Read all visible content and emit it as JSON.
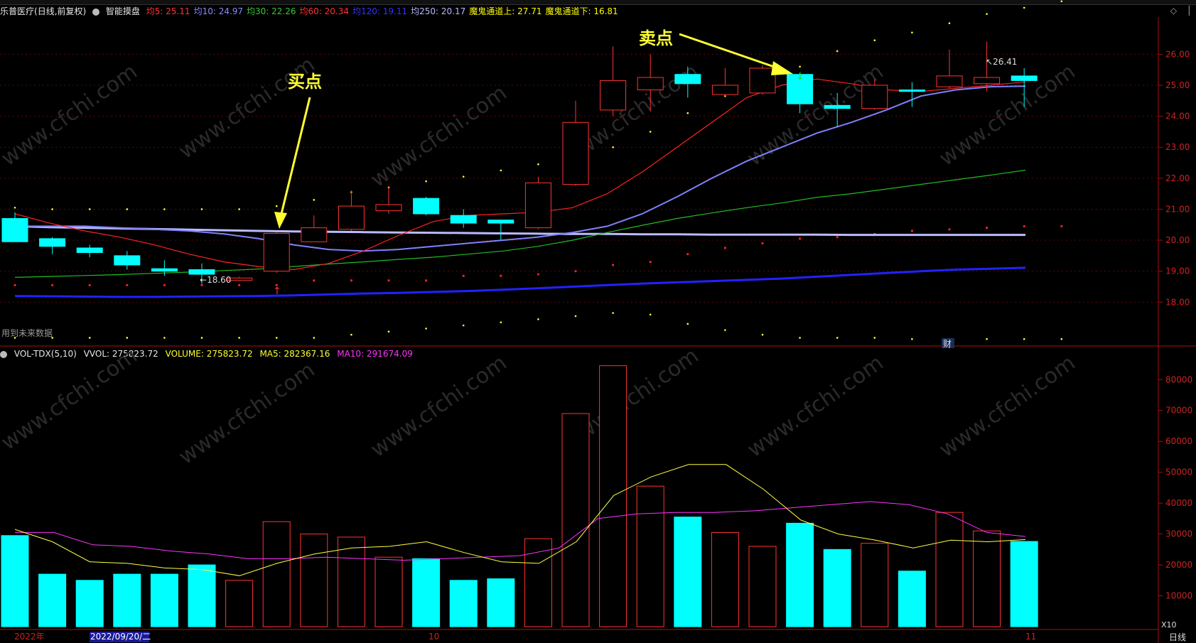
{
  "header": {
    "stock": "乐普医疗",
    "period": "(日线,前复权)",
    "indicator_name": "智能摸盘",
    "ma_labels": [
      {
        "text": "均5: 25.11",
        "color": "#ff3333"
      },
      {
        "text": "均10: 24.97",
        "color": "#8a8aff"
      },
      {
        "text": "均30: 22.26",
        "color": "#33cc33"
      },
      {
        "text": "均60: 20.34",
        "color": "#ff3333"
      },
      {
        "text": "均120: 19.11",
        "color": "#3333ff"
      },
      {
        "text": "均250: 20.17",
        "color": "#b8b8ff"
      },
      {
        "text": "魔鬼通道上: 27.71",
        "color": "#ffff00"
      },
      {
        "text": "魔鬼通道下: 16.81",
        "color": "#ffff00"
      }
    ]
  },
  "vol_header": {
    "name": "VOL-TDX(5,10)",
    "vvol": "VVOL: 275823.72",
    "volume": "VOLUME: 275823.72",
    "ma5": "MA5: 282367.16",
    "ma10": "MA10: 291674.09"
  },
  "annotations": {
    "buy": "买点",
    "sell": "卖点",
    "future_data": "用到未来数据",
    "cai": "财",
    "min_label": "18.60",
    "max_label": "26.41"
  },
  "x_axis": {
    "year": "2022年",
    "cursor_date": "2022/09/20/二",
    "oct": "10",
    "nov": "11",
    "period_tab": "日线",
    "zoom": "X10"
  },
  "colors": {
    "up": "#ff3333",
    "down": "#00ffff",
    "ma5": "#ff2222",
    "ma10": "#8080ff",
    "ma30": "#22bb22",
    "ma60": "#bbbbff",
    "ma120": "#2222ff",
    "vol_ma5": "#ffff44",
    "vol_ma10": "#ff33ff"
  },
  "chart_data": [
    {
      "type": "candlestick",
      "yticks": [
        18.0,
        19.0,
        20.0,
        21.0,
        22.0,
        23.0,
        24.0,
        25.0,
        26.0
      ],
      "ylim": [
        16.7,
        27.2
      ],
      "candles": [
        {
          "o": 20.7,
          "c": 19.95,
          "h": 20.9,
          "l": 19.95
        },
        {
          "o": 20.05,
          "c": 19.8,
          "h": 20.1,
          "l": 19.55
        },
        {
          "o": 19.75,
          "c": 19.6,
          "h": 19.85,
          "l": 19.45
        },
        {
          "o": 19.5,
          "c": 19.2,
          "h": 19.65,
          "l": 19.05
        },
        {
          "o": 19.08,
          "c": 19.0,
          "h": 19.35,
          "l": 18.85
        },
        {
          "o": 19.05,
          "c": 18.9,
          "h": 19.25,
          "l": 18.6
        },
        {
          "o": 18.7,
          "c": 18.78,
          "h": 18.82,
          "l": 18.68
        },
        {
          "o": 19.0,
          "c": 20.22,
          "h": 20.25,
          "l": 18.95
        },
        {
          "o": 19.95,
          "c": 20.4,
          "h": 20.8,
          "l": 19.95
        },
        {
          "o": 20.35,
          "c": 21.1,
          "h": 21.6,
          "l": 20.3
        },
        {
          "o": 20.95,
          "c": 21.15,
          "h": 21.75,
          "l": 20.85
        },
        {
          "o": 21.35,
          "c": 20.85,
          "h": 21.4,
          "l": 20.8
        },
        {
          "o": 20.8,
          "c": 20.55,
          "h": 21.0,
          "l": 20.4
        },
        {
          "o": 20.65,
          "c": 20.55,
          "h": 20.65,
          "l": 20.0
        },
        {
          "o": 20.4,
          "c": 21.85,
          "h": 22.05,
          "l": 20.35
        },
        {
          "o": 21.8,
          "c": 23.8,
          "h": 24.5,
          "l": 21.75
        },
        {
          "o": 24.2,
          "c": 25.15,
          "h": 26.25,
          "l": 24.0
        },
        {
          "o": 24.85,
          "c": 25.25,
          "h": 26.0,
          "l": 24.15
        },
        {
          "o": 25.35,
          "c": 25.05,
          "h": 25.6,
          "l": 24.6
        },
        {
          "o": 24.7,
          "c": 25.0,
          "h": 25.55,
          "l": 24.65
        },
        {
          "o": 24.75,
          "c": 25.55,
          "h": 25.65,
          "l": 24.7
        },
        {
          "o": 25.35,
          "c": 24.4,
          "h": 25.4,
          "l": 24.1
        },
        {
          "o": 24.35,
          "c": 24.25,
          "h": 24.75,
          "l": 23.65
        },
        {
          "o": 24.25,
          "c": 25.0,
          "h": 25.2,
          "l": 24.2
        },
        {
          "o": 24.85,
          "c": 24.8,
          "h": 25.1,
          "l": 24.3
        },
        {
          "o": 24.95,
          "c": 25.3,
          "h": 26.15,
          "l": 24.9
        },
        {
          "o": 25.05,
          "c": 25.25,
          "h": 26.41,
          "l": 24.8
        },
        {
          "o": 25.3,
          "c": 25.15,
          "h": 25.55,
          "l": 24.3
        }
      ],
      "ma5": [
        20.85,
        20.55,
        20.3,
        20.1,
        19.85,
        19.55,
        19.3,
        19.15,
        19.05,
        19.25,
        19.65,
        20.15,
        20.6,
        20.8,
        20.85,
        20.9,
        21.05,
        21.5,
        22.2,
        23.0,
        23.8,
        24.6,
        25.0,
        25.2,
        25.05,
        24.85,
        24.8,
        24.9,
        25.0,
        25.11
      ],
      "ma10": [
        20.45,
        20.45,
        20.45,
        20.4,
        20.35,
        20.3,
        20.2,
        20.05,
        19.85,
        19.7,
        19.65,
        19.7,
        19.8,
        19.9,
        20.0,
        20.1,
        20.25,
        20.45,
        20.85,
        21.4,
        22.0,
        22.55,
        23.0,
        23.45,
        23.8,
        24.2,
        24.65,
        24.85,
        24.95,
        24.97
      ],
      "ma30": [
        18.8,
        18.83,
        18.86,
        18.89,
        18.93,
        18.97,
        19.02,
        19.07,
        19.15,
        19.23,
        19.3,
        19.38,
        19.45,
        19.55,
        19.65,
        19.8,
        20.0,
        20.25,
        20.48,
        20.7,
        20.88,
        21.05,
        21.2,
        21.38,
        21.5,
        21.65,
        21.8,
        21.95,
        22.1,
        22.26
      ],
      "ma60": [
        20.5,
        20.49,
        20.48,
        20.47,
        20.46,
        20.45,
        20.44,
        20.43,
        20.42,
        20.41,
        20.4,
        20.39,
        20.38,
        20.37,
        20.36,
        20.35,
        20.35,
        20.35,
        20.34,
        20.34,
        20.34,
        20.34,
        20.34,
        20.34,
        20.34,
        20.34,
        20.34,
        20.34,
        20.34,
        20.34
      ],
      "ma120": [
        18.2,
        18.19,
        18.18,
        18.17,
        18.17,
        18.18,
        18.19,
        18.2,
        18.22,
        18.25,
        18.28,
        18.3,
        18.33,
        18.36,
        18.4,
        18.45,
        18.5,
        18.55,
        18.6,
        18.64,
        18.68,
        18.72,
        18.76,
        18.82,
        18.88,
        18.94,
        19.0,
        19.05,
        19.08,
        19.11
      ],
      "ma250": [
        20.45,
        20.42,
        20.4,
        20.38,
        20.36,
        20.34,
        20.32,
        20.3,
        20.28,
        20.27,
        20.26,
        20.25,
        20.24,
        20.23,
        20.22,
        20.21,
        20.2,
        20.2,
        20.19,
        20.19,
        20.18,
        20.18,
        20.18,
        20.18,
        20.17,
        20.17,
        20.17,
        20.17,
        20.17,
        20.17
      ],
      "channel_upper": [
        21.05,
        21.0,
        21.0,
        21.0,
        21.0,
        21.0,
        21.0,
        21.1,
        21.3,
        21.55,
        21.7,
        21.9,
        22.05,
        22.25,
        22.45,
        22.7,
        23.0,
        23.5,
        24.1,
        24.65,
        25.2,
        25.6,
        26.1,
        26.45,
        26.7,
        27.0,
        27.3,
        27.5,
        27.71
      ],
      "channel_lower": [
        16.85,
        16.85,
        16.85,
        16.85,
        16.85,
        16.85,
        16.85,
        16.85,
        16.85,
        16.95,
        17.05,
        17.15,
        17.25,
        17.35,
        17.45,
        17.55,
        17.65,
        17.6,
        17.3,
        17.1,
        16.95,
        16.85,
        16.85,
        16.85,
        16.81,
        16.81,
        16.81,
        16.81,
        16.81
      ],
      "red_dots": [
        18.55,
        18.55,
        18.55,
        18.55,
        18.55,
        18.55,
        18.55,
        18.55,
        18.7,
        18.7,
        18.7,
        18.7,
        18.85,
        18.85,
        18.9,
        19.0,
        19.2,
        19.3,
        19.55,
        19.75,
        19.9,
        20.05,
        20.1,
        20.2,
        20.3,
        20.35,
        20.4,
        20.45,
        20.45
      ]
    },
    {
      "type": "bar",
      "yticks": [
        10000,
        20000,
        30000,
        40000,
        50000,
        60000,
        70000,
        80000
      ],
      "ylim": [
        0,
        86500
      ],
      "volume": [
        29500,
        17000,
        15000,
        17000,
        17000,
        20000,
        15000,
        34000,
        30000,
        29000,
        22500,
        22000,
        15000,
        15500,
        28500,
        69000,
        84500,
        45500,
        35500,
        30500,
        26000,
        33500,
        25000,
        27000,
        18000,
        37000,
        31000,
        27600
      ],
      "ma5": [
        31500,
        27500,
        21000,
        20500,
        19000,
        18500,
        16500,
        20500,
        23500,
        25500,
        26000,
        27500,
        24000,
        21000,
        20500,
        27500,
        42500,
        48500,
        52500,
        52500,
        44500,
        34500,
        30000,
        28000,
        25500,
        28000,
        27500,
        28200
      ],
      "ma10": [
        30500,
        30500,
        26500,
        26000,
        24500,
        23500,
        22000,
        22000,
        22500,
        22000,
        21500,
        22000,
        22500,
        23000,
        25500,
        35000,
        36500,
        37000,
        37000,
        37500,
        38500,
        39500,
        40500,
        39500,
        36500,
        30500,
        29200
      ]
    }
  ]
}
